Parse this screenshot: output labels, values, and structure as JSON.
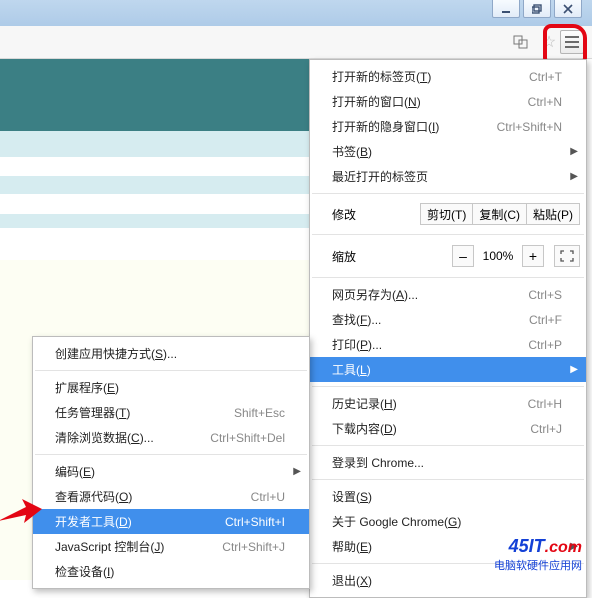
{
  "titlebar": {
    "minimize": "min",
    "maximize": "max",
    "close": "close"
  },
  "toolbar": {
    "translate": "译",
    "star": "★"
  },
  "menu": {
    "new_tab": {
      "label": "打开新的标签页",
      "key": "T",
      "shortcut": "Ctrl+T"
    },
    "new_window": {
      "label": "打开新的窗口",
      "key": "N",
      "shortcut": "Ctrl+N"
    },
    "incognito": {
      "label": "打开新的隐身窗口",
      "key": "I",
      "shortcut": "Ctrl+Shift+N"
    },
    "bookmarks": {
      "label": "书签",
      "key": "B"
    },
    "recent_tabs": {
      "label": "最近打开的标签页"
    },
    "edit": {
      "label": "修改",
      "cut": "剪切(T)",
      "copy": "复制(C)",
      "paste": "粘贴(P)"
    },
    "zoom": {
      "label": "缩放",
      "value": "100%"
    },
    "save_as": {
      "label": "网页另存为",
      "key": "A",
      "shortcut": "Ctrl+S"
    },
    "find": {
      "label": "查找",
      "key": "F",
      "shortcut": "Ctrl+F"
    },
    "print": {
      "label": "打印",
      "key": "P",
      "shortcut": "Ctrl+P"
    },
    "tools": {
      "label": "工具",
      "key": "L"
    },
    "history": {
      "label": "历史记录",
      "key": "H",
      "shortcut": "Ctrl+H"
    },
    "downloads": {
      "label": "下载内容",
      "key": "D",
      "shortcut": "Ctrl+J"
    },
    "signin": {
      "label": "登录到 Chrome..."
    },
    "settings": {
      "label": "设置",
      "key": "S"
    },
    "about": {
      "label": "关于 Google Chrome",
      "key": "G"
    },
    "help": {
      "label": "帮助",
      "key": "E"
    },
    "exit": {
      "label": "退出",
      "key": "X"
    }
  },
  "submenu": {
    "create_shortcut": {
      "label": "创建应用快捷方式",
      "key": "S"
    },
    "extensions": {
      "label": "扩展程序",
      "key": "E"
    },
    "task_manager": {
      "label": "任务管理器",
      "key": "T",
      "shortcut": "Shift+Esc"
    },
    "clear_data": {
      "label": "清除浏览数据",
      "key": "C",
      "shortcut": "Ctrl+Shift+Del"
    },
    "encoding": {
      "label": "编码",
      "key": "E"
    },
    "view_source": {
      "label": "查看源代码",
      "key": "O",
      "shortcut": "Ctrl+U"
    },
    "dev_tools": {
      "label": "开发者工具",
      "key": "D",
      "shortcut": "Ctrl+Shift+I"
    },
    "js_console": {
      "label": "JavaScript 控制台",
      "key": "J",
      "shortcut": "Ctrl+Shift+J"
    },
    "inspect": {
      "label": "检查设备",
      "key": "I"
    }
  },
  "watermark": {
    "brand1": "45IT",
    "brand2": ".com",
    "sub": "电脑软硬件应用网"
  }
}
